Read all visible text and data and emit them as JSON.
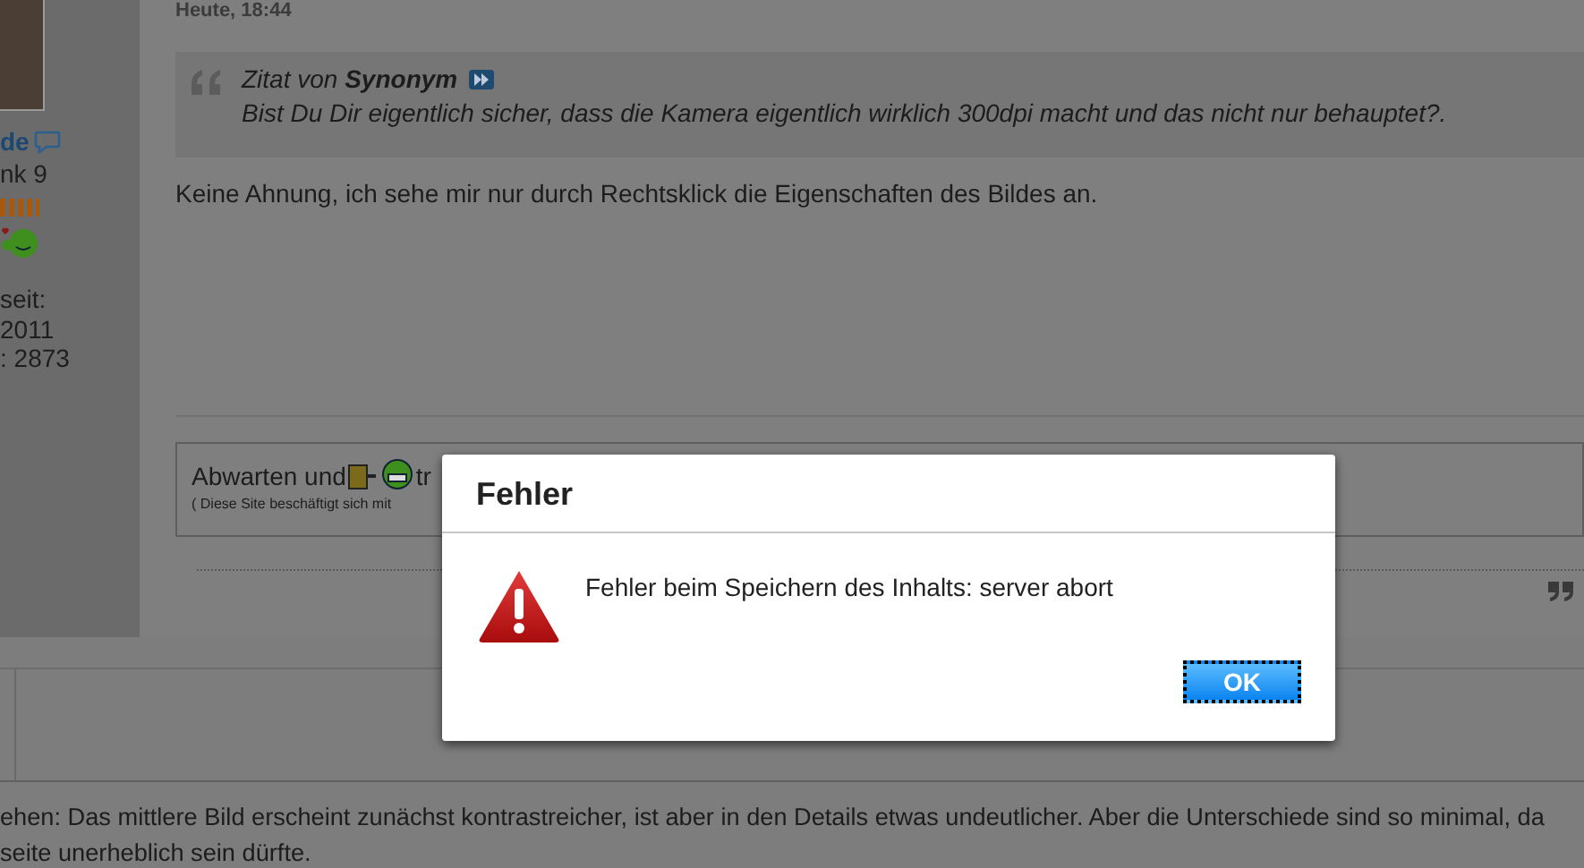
{
  "sidebar": {
    "username": "de",
    "rank": "nk 9",
    "member_since_label": "seit:",
    "member_since": "2011",
    "posts": ": 2873"
  },
  "post": {
    "timestamp": "Heute, 18:44",
    "quote": {
      "prefix": "Zitat von",
      "author": "Synonym",
      "text": "Bist Du Dir eigentlich sicher, dass die Kamera eigentlich wirklich 300dpi macht und das nicht nur behauptet?."
    },
    "body": "Keine Ahnung, ich sehe mir nur durch Rechtsklick die Eigenschaften des Bildes an.",
    "signature": {
      "line_start": "Abwarten und",
      "line_end": "tr",
      "small_line": "( Diese Site beschäftigt sich mit"
    }
  },
  "footer_lines": [
    "ehen: Das mittlere Bild erscheint zunächst kontrastreicher, ist aber in den Details etwas undeutlicher. Aber die Unterschiede sind so minimal, da",
    "seite unerheblich sein dürfte."
  ],
  "dialog": {
    "title": "Fehler",
    "message": "Fehler beim Speichern des Inhalts: server abort",
    "buttons": [
      {
        "label": "OK",
        "focused": true
      }
    ]
  }
}
